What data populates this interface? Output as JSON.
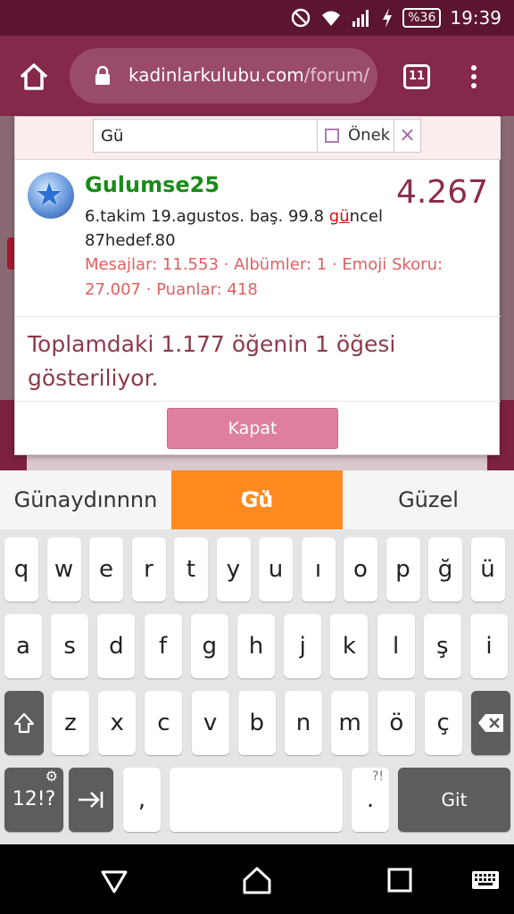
{
  "status_bar": {
    "battery": "%36",
    "time": "19:39"
  },
  "browser": {
    "url_host": "kadinlarkulubu.com",
    "url_path": "/forum/",
    "tab_count": "11"
  },
  "search": {
    "value": "Gü",
    "prefix_label": "Önek",
    "clear_symbol": "×"
  },
  "result": {
    "username": "Gulumse25",
    "score": "4.267",
    "status_pre": "6.takim 19.agustos. baş. 99.8 ",
    "status_hl": "gü",
    "status_post": "ncel 87hedef.80",
    "stats": "Mesajlar: 11.553 · Albümler: 1 · Emoji Skoru: 27.007 · Puanlar: 418"
  },
  "summary": "Toplamdaki 1.177 öğenin 1 öğesi gösteriliyor.",
  "close_button": "Kapat",
  "suggestions": {
    "left": "Günaydınnnn",
    "center": "Gü",
    "center_dots": "•••",
    "right": "Güzel"
  },
  "keyboard": {
    "row1": [
      "q",
      "w",
      "e",
      "r",
      "t",
      "y",
      "u",
      "ı",
      "o",
      "p",
      "ğ",
      "ü"
    ],
    "row2": [
      "a",
      "s",
      "d",
      "f",
      "g",
      "h",
      "j",
      "k",
      "l",
      "ş",
      "i"
    ],
    "row3": [
      "z",
      "x",
      "c",
      "v",
      "b",
      "n",
      "m",
      "ö",
      "ç"
    ],
    "symbols_key": "12!?",
    "comma_key": ",",
    "period_key": ".",
    "period_sub": "?!",
    "go_key": "Git"
  }
}
